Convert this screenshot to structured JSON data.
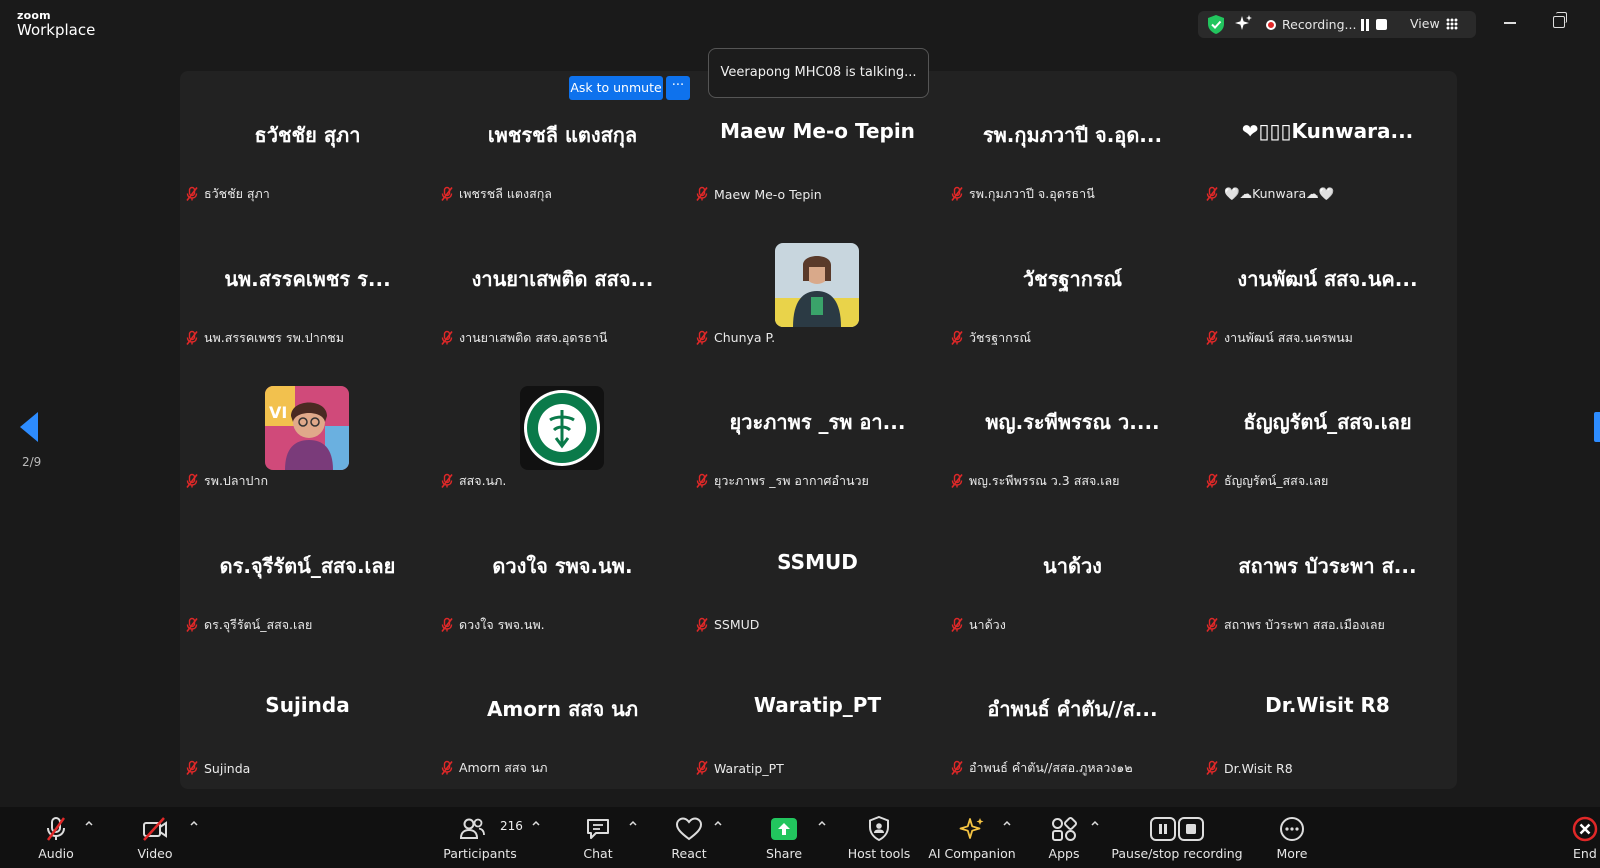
{
  "app": {
    "brand_small": "zoom",
    "brand_name": "Workplace"
  },
  "recording": {
    "status_text": "Recording...",
    "view_label": "View"
  },
  "toast": {
    "text": "Veerapong MHC08 is talking..."
  },
  "unmute": {
    "label": "Ask to unmute",
    "more": "···"
  },
  "pagination": {
    "current": "2/9",
    "right": "2"
  },
  "participants": [
    {
      "display": "ธวัชชัย สุภา",
      "label": "ธวัชชัย สุภา",
      "avatar": ""
    },
    {
      "display": "เพชรชลี แตงสกุล",
      "label": "เพชรชลี แตงสกุล",
      "avatar": ""
    },
    {
      "display": "Maew Me-o Tepin",
      "label": "Maew Me-o Tepin",
      "avatar": ""
    },
    {
      "display": "รพ.กุมภวาปี จ.อุด...",
      "label": "รพ.กุมภวาปี จ.อุดรธานี",
      "avatar": ""
    },
    {
      "display": "❤▯▯▯Kunwara...",
      "label": "🤍☁Kunwara☁🤍",
      "avatar": ""
    },
    {
      "display": "นพ.สรรคเพชร ร...",
      "label": "นพ.สรรคเพชร รพ.ปากชม",
      "avatar": ""
    },
    {
      "display": "งานยาเสพติด สสจ...",
      "label": "งานยาเสพติด สสจ.อุดรธานี",
      "avatar": ""
    },
    {
      "display": "",
      "label": "Chunya P.",
      "avatar": "photo-woman"
    },
    {
      "display": "วัชรฐากรณ์",
      "label": "วัชรฐากรณ์",
      "avatar": ""
    },
    {
      "display": "งานพัฒน์ สสจ.นค...",
      "label": "งานพัฒน์ สสจ.นครพนม",
      "avatar": ""
    },
    {
      "display": "",
      "label": "รพ.ปลาปาก",
      "avatar": "photo-elder"
    },
    {
      "display": "",
      "label": "สสจ.นภ.",
      "avatar": "moph-logo"
    },
    {
      "display": "ยุวะภาพร _รพ อา...",
      "label": "ยุวะภาพร _รพ อากาศอำนวย",
      "avatar": ""
    },
    {
      "display": "พญ.ระพีพรรณ ว....",
      "label": "พญ.ระพีพรรณ ว.3 สสจ.เลย",
      "avatar": ""
    },
    {
      "display": "ธัญญรัตน์_สสจ.เลย",
      "label": "ธัญญรัตน์_สสจ.เลย",
      "avatar": ""
    },
    {
      "display": "ดร.จุรีรัตน์_สสจ.เลย",
      "label": "ดร.จุรีรัตน์_สสจ.เลย",
      "avatar": ""
    },
    {
      "display": "ดวงใจ รพจ.นพ.",
      "label": "ดวงใจ รพจ.นพ.",
      "avatar": ""
    },
    {
      "display": "SSMUD",
      "label": "SSMUD",
      "avatar": ""
    },
    {
      "display": "นาด้วง",
      "label": "นาด้วง",
      "avatar": ""
    },
    {
      "display": "สถาพร บัวระพา ส...",
      "label": "สถาพร บัวระพา สสอ.เมืองเลย",
      "avatar": ""
    },
    {
      "display": "Sujinda",
      "label": "Sujinda",
      "avatar": ""
    },
    {
      "display": "Amorn สสจ นภ",
      "label": "Amorn สสจ นภ",
      "avatar": ""
    },
    {
      "display": "Waratip_PT",
      "label": "Waratip_PT",
      "avatar": ""
    },
    {
      "display": "อำพนธ์ คำตัน//ส...",
      "label": "อำพนธ์ คำตัน//สสอ.ภูหลวง๑๒",
      "avatar": ""
    },
    {
      "display": "Dr.Wisit R8",
      "label": "Dr.Wisit R8",
      "avatar": ""
    }
  ],
  "toolbar": {
    "audio": "Audio",
    "video": "Video",
    "participants": "Participants",
    "participants_count": "216",
    "chat": "Chat",
    "react": "React",
    "share": "Share",
    "host_tools": "Host tools",
    "ai_companion": "AI Companion",
    "apps": "Apps",
    "pause_stop": "Pause/stop recording",
    "more": "More",
    "end": "End"
  },
  "colors": {
    "accent": "#0e72ed",
    "share_green": "#22c55e",
    "muted_red": "#e02828",
    "tile_bg": "#222222"
  }
}
